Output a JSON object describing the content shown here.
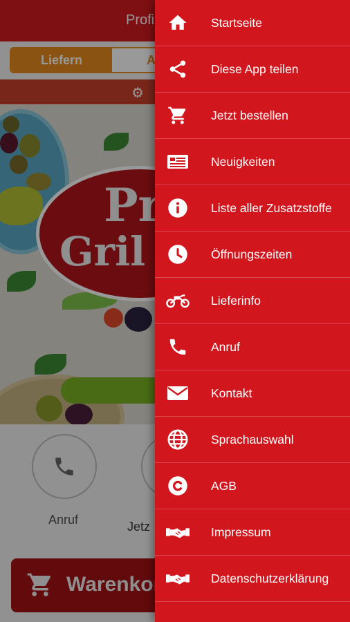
{
  "app": {
    "title": "Profi",
    "tabs": {
      "deliver": "Liefern",
      "pickup": "Abho"
    },
    "logo": {
      "line1": "Pr",
      "line2": "Gril"
    },
    "actions": {
      "call": "Anruf",
      "order": "Jetz"
    },
    "cart_label": "Warenkorb"
  },
  "drawer": {
    "items": [
      {
        "label": "Startseite",
        "icon": "home-icon"
      },
      {
        "label": "Diese App teilen",
        "icon": "share-icon"
      },
      {
        "label": "Jetzt bestellen",
        "icon": "cart-icon"
      },
      {
        "label": "Neuigkeiten",
        "icon": "news-icon"
      },
      {
        "label": "Liste aller Zusatzstoffe",
        "icon": "info-icon"
      },
      {
        "label": "Öffnungszeiten",
        "icon": "clock-icon"
      },
      {
        "label": "Lieferinfo",
        "icon": "motorbike-icon"
      },
      {
        "label": "Anruf",
        "icon": "phone-icon"
      },
      {
        "label": "Kontakt",
        "icon": "envelope-icon"
      },
      {
        "label": "Sprachauswahl",
        "icon": "globe-icon"
      },
      {
        "label": "AGB",
        "icon": "copyright-icon"
      },
      {
        "label": "Impressum",
        "icon": "handshake-icon"
      },
      {
        "label": "Datenschutzerklärung",
        "icon": "handshake-icon"
      }
    ]
  },
  "colors": {
    "drawer": "#d2161d",
    "header": "#d21a1f",
    "tab_accent": "#e88a1e",
    "cart": "#a51217"
  }
}
